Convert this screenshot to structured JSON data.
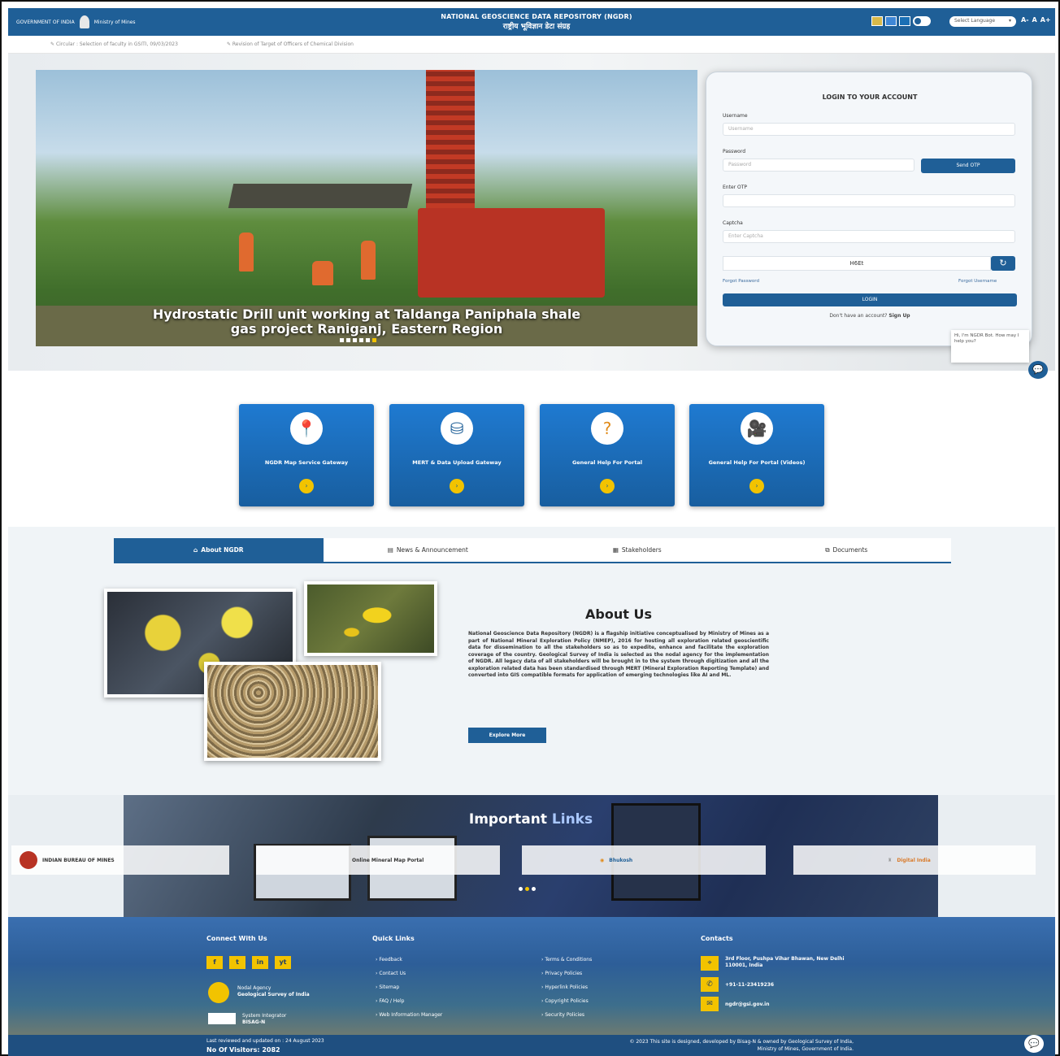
{
  "header": {
    "gov_left": "GOVERNMENT OF INDIA",
    "gov_right": "Ministry of Mines",
    "title_en": "NATIONAL GEOSCIENCE DATA REPOSITORY (NGDR)",
    "title_hi": "राष्ट्रीय भूविज्ञान डेटा संग्रह",
    "language_select": "Select Language",
    "font_small": "A-",
    "font_normal": "A",
    "font_large": "A+",
    "theme_colors": [
      "#d8b94a",
      "#3f87d6",
      "#1a6fb5"
    ]
  },
  "ticker": {
    "item1": "Circular : Selection of faculty in GSITI, 09/03/2023",
    "item2": "Revision of Target of Officers of Chemical Division"
  },
  "hero": {
    "caption_line1": "Hydrostatic Drill unit working at Taldanga Paniphala shale",
    "caption_line2": "gas project Raniganj, Eastern Region",
    "slide_count": 6,
    "active_slide": 6
  },
  "login": {
    "title": "LOGIN TO YOUR ACCOUNT",
    "username_label": "Username",
    "username_placeholder": "Username",
    "password_label": "Password",
    "password_placeholder": "Password",
    "send_otp": "Send OTP",
    "otp_label": "Enter OTP",
    "captcha_label": "Captcha",
    "captcha_placeholder": "Enter Captcha",
    "captcha_value": "H6Et",
    "forgot_password": "Forgot Password",
    "forgot_username": "Forgot Username",
    "login_button": "LOGIN",
    "signup_prompt": "Don't have an account?",
    "signup_link": "Sign Up"
  },
  "chat": {
    "tooltip": "Hi, I'm NGDR Bot. How may I help you?"
  },
  "cards": [
    {
      "label": "NGDR Map Service Gateway",
      "icon": "map-pin-icon"
    },
    {
      "label": "MERT & Data Upload Gateway",
      "icon": "database-upload-icon"
    },
    {
      "label": "General Help For Portal",
      "icon": "help-icon"
    },
    {
      "label": "General Help For Portal (Videos)",
      "icon": "video-camera-icon"
    }
  ],
  "tabs": [
    {
      "label": "About NGDR",
      "icon": "home-icon"
    },
    {
      "label": "News & Announcement",
      "icon": "news-icon"
    },
    {
      "label": "Stakeholders",
      "icon": "users-icon"
    },
    {
      "label": "Documents",
      "icon": "documents-icon"
    }
  ],
  "about": {
    "title": "About Us",
    "body": "National Geoscience Data Repository (NGDR) is a flagship initiative conceptualised by Ministry of Mines as a part of National Mineral Exploration Policy (NMEP), 2016 for hosting all exploration related geoscientific data for dissemination to all the stakeholders so as to expedite, enhance and facilitate the exploration coverage of the country. Geological Survey of India is selected as the nodal agency for the implementation of NGDR. All legacy data of all stakeholders will be brought in to the system through digitization and all the exploration related data has been standardised through MERT (Mineral Exploration Reporting Template) and converted into GIS compatible formats for application of emerging technologies like AI and ML.",
    "explore_button": "Explore More"
  },
  "important_links": {
    "title_a": "Important",
    "title_b": "Links",
    "logos": [
      "INDIAN BUREAU OF MINES",
      "Online Mineral Map Portal",
      "Bhukosh",
      "Digital India"
    ]
  },
  "footer": {
    "connect_title": "Connect With Us",
    "social": [
      "f",
      "t",
      "in",
      "yt"
    ],
    "nodal_label": "Nodal Agency",
    "nodal_name": "Geological Survey of India",
    "integrator_label": "System Integrator",
    "integrator_name": "BISAG-N",
    "quick_title": "Quick Links",
    "quick_col1": [
      "Feedback",
      "Contact Us",
      "Sitemap",
      "FAQ / Help",
      "Web Information Manager"
    ],
    "quick_col2": [
      "Terms & Conditions",
      "Privacy Policies",
      "Hyperlink Policies",
      "Copyright Policies",
      "Security Policies"
    ],
    "contacts_title": "Contacts",
    "address": "3rd Floor, Pushpa Vihar Bhawan, New Delhi 110001, India",
    "phone": "+91-11-23419236",
    "email": "ngdr@gsi.gov.in",
    "updated": "Last reviewed and updated on : 24 August 2023",
    "visitors": "No Of Visitors: 2082",
    "copyright": "© 2023 This site is designed, developed by Bisag-N & owned by Geological Survey of India,",
    "copyright2": "Ministry of Mines, Government of India."
  }
}
